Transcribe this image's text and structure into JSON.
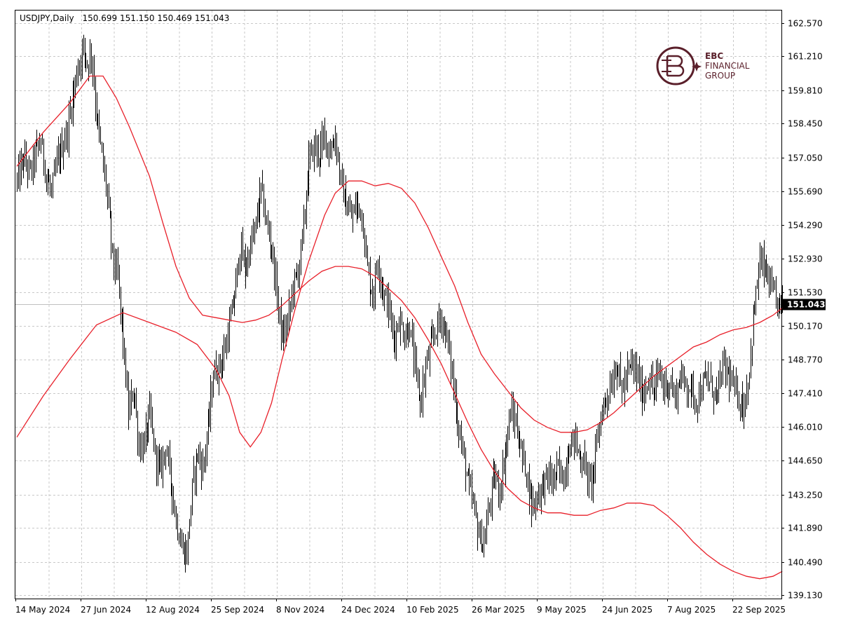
{
  "header": {
    "symbol": "USDJPY,Daily",
    "ohlc": "150.699 151.150 150.469 151.043"
  },
  "logo": {
    "line1": "EBC",
    "line2": "FINANCIAL",
    "line3": "GROUP",
    "color": "#5a1f2a",
    "icon": "ebc-logo-icon"
  },
  "colors": {
    "bars": "#000000",
    "ma": "#e8202a",
    "grid": "#c8c8c8",
    "price_line": "#c0c0c0",
    "price_tag_bg": "#000000",
    "price_tag_text": "#ffffff"
  },
  "chart_data": {
    "type": "ohlc-bar",
    "x_labels": [
      "14 May 2024",
      "27 Jun 2024",
      "12 Aug 2024",
      "25 Sep 2024",
      "8 Nov 2024",
      "24 Dec 2024",
      "10 Feb 2025",
      "26 Mar 2025",
      "9 May 2025",
      "24 Jun 2025",
      "7 Aug 2025",
      "22 Sep 2025"
    ],
    "y_labels": [
      "162.570",
      "161.210",
      "159.810",
      "158.450",
      "157.050",
      "155.690",
      "154.290",
      "152.930",
      "151.530",
      "150.170",
      "148.770",
      "147.410",
      "146.010",
      "144.650",
      "143.250",
      "141.890",
      "140.490",
      "139.130"
    ],
    "ylim": [
      139.13,
      162.57
    ],
    "current_price": 151.043,
    "current_price_label": "151.043",
    "grid": true,
    "close_path": [
      [
        0,
        156.1
      ],
      [
        5,
        157.0
      ],
      [
        10,
        156.4
      ],
      [
        14,
        157.3
      ],
      [
        18,
        157.7
      ],
      [
        22,
        156.3
      ],
      [
        26,
        155.6
      ],
      [
        30,
        156.8
      ],
      [
        34,
        157.5
      ],
      [
        38,
        158.2
      ],
      [
        42,
        159.6
      ],
      [
        46,
        160.8
      ],
      [
        50,
        161.6
      ],
      [
        53,
        160.9
      ],
      [
        56,
        161.4
      ],
      [
        60,
        158.8
      ],
      [
        64,
        157.1
      ],
      [
        68,
        155.5
      ],
      [
        72,
        153.0
      ],
      [
        76,
        152.1
      ],
      [
        80,
        149.5
      ],
      [
        84,
        146.6
      ],
      [
        88,
        147.6
      ],
      [
        92,
        145.2
      ],
      [
        96,
        145.3
      ],
      [
        100,
        146.6
      ],
      [
        104,
        144.9
      ],
      [
        108,
        144.2
      ],
      [
        112,
        145.3
      ],
      [
        116,
        143.8
      ],
      [
        120,
        142.2
      ],
      [
        124,
        141.1
      ],
      [
        128,
        140.8
      ],
      [
        132,
        143.5
      ],
      [
        136,
        145.0
      ],
      [
        140,
        144.3
      ],
      [
        144,
        146.0
      ],
      [
        148,
        148.2
      ],
      [
        152,
        148.5
      ],
      [
        156,
        149.0
      ],
      [
        160,
        150.1
      ],
      [
        164,
        151.4
      ],
      [
        168,
        153.4
      ],
      [
        172,
        152.5
      ],
      [
        176,
        153.4
      ],
      [
        180,
        154.3
      ],
      [
        184,
        155.8
      ],
      [
        188,
        154.3
      ],
      [
        192,
        153.4
      ],
      [
        196,
        151.4
      ],
      [
        200,
        149.6
      ],
      [
        204,
        150.3
      ],
      [
        208,
        151.8
      ],
      [
        212,
        152.4
      ],
      [
        216,
        154.2
      ],
      [
        220,
        156.9
      ],
      [
        224,
        157.5
      ],
      [
        228,
        157.2
      ],
      [
        232,
        158.0
      ],
      [
        236,
        157.3
      ],
      [
        240,
        157.9
      ],
      [
        244,
        156.1
      ],
      [
        248,
        155.1
      ],
      [
        252,
        154.6
      ],
      [
        256,
        155.1
      ],
      [
        260,
        154.8
      ],
      [
        264,
        152.5
      ],
      [
        268,
        151.4
      ],
      [
        272,
        152.9
      ],
      [
        276,
        151.5
      ],
      [
        280,
        151.0
      ],
      [
        284,
        149.6
      ],
      [
        288,
        150.4
      ],
      [
        292,
        149.8
      ],
      [
        296,
        150.1
      ],
      [
        300,
        148.4
      ],
      [
        304,
        147.0
      ],
      [
        308,
        148.4
      ],
      [
        312,
        149.3
      ],
      [
        316,
        150.1
      ],
      [
        320,
        150.5
      ],
      [
        324,
        149.7
      ],
      [
        328,
        148.2
      ],
      [
        332,
        146.3
      ],
      [
        336,
        145.0
      ],
      [
        340,
        143.7
      ],
      [
        344,
        142.8
      ],
      [
        348,
        141.6
      ],
      [
        352,
        141.2
      ],
      [
        356,
        142.8
      ],
      [
        360,
        144.0
      ],
      [
        364,
        143.4
      ],
      [
        368,
        145.0
      ],
      [
        372,
        146.6
      ],
      [
        376,
        146.2
      ],
      [
        380,
        145.0
      ],
      [
        384,
        144.2
      ],
      [
        388,
        142.8
      ],
      [
        392,
        143.2
      ],
      [
        396,
        143.6
      ],
      [
        400,
        144.0
      ],
      [
        404,
        143.8
      ],
      [
        408,
        144.3
      ],
      [
        412,
        143.9
      ],
      [
        416,
        145.2
      ],
      [
        420,
        145.6
      ],
      [
        424,
        144.8
      ],
      [
        428,
        144.5
      ],
      [
        432,
        143.6
      ],
      [
        436,
        144.8
      ],
      [
        440,
        146.5
      ],
      [
        444,
        147.2
      ],
      [
        448,
        147.8
      ],
      [
        452,
        148.6
      ],
      [
        456,
        147.5
      ],
      [
        460,
        148.2
      ],
      [
        464,
        148.6
      ],
      [
        468,
        148.0
      ],
      [
        472,
        147.3
      ],
      [
        476,
        148.1
      ],
      [
        480,
        147.4
      ],
      [
        484,
        148.3
      ],
      [
        488,
        147.6
      ],
      [
        492,
        147.9
      ],
      [
        496,
        147.2
      ],
      [
        500,
        148.1
      ],
      [
        504,
        147.8
      ],
      [
        508,
        147.6
      ],
      [
        512,
        147.1
      ],
      [
        516,
        147.6
      ],
      [
        520,
        148.0
      ],
      [
        524,
        147.6
      ],
      [
        528,
        147.3
      ],
      [
        532,
        148.5
      ],
      [
        536,
        148.2
      ],
      [
        540,
        147.6
      ],
      [
        544,
        147.2
      ],
      [
        548,
        146.8
      ],
      [
        552,
        148.4
      ],
      [
        556,
        151.0
      ],
      [
        560,
        152.8
      ],
      [
        564,
        152.4
      ],
      [
        568,
        151.7
      ],
      [
        572,
        151.1
      ],
      [
        577,
        151.04
      ]
    ],
    "ma_fast": [
      [
        0,
        145.6
      ],
      [
        20,
        147.3
      ],
      [
        40,
        148.8
      ],
      [
        60,
        150.2
      ],
      [
        80,
        150.7
      ],
      [
        100,
        150.3
      ],
      [
        120,
        149.9
      ],
      [
        136,
        149.4
      ],
      [
        150,
        148.4
      ],
      [
        160,
        147.3
      ],
      [
        168,
        145.8
      ],
      [
        176,
        145.2
      ],
      [
        184,
        145.8
      ],
      [
        192,
        147.0
      ],
      [
        200,
        148.8
      ],
      [
        210,
        150.9
      ],
      [
        220,
        152.8
      ],
      [
        232,
        154.7
      ],
      [
        240,
        155.6
      ],
      [
        250,
        156.1
      ],
      [
        260,
        156.1
      ],
      [
        270,
        155.9
      ],
      [
        280,
        156.0
      ],
      [
        290,
        155.8
      ],
      [
        300,
        155.2
      ],
      [
        310,
        154.2
      ],
      [
        320,
        153.0
      ],
      [
        330,
        151.8
      ],
      [
        340,
        150.3
      ],
      [
        350,
        149.0
      ],
      [
        360,
        148.2
      ],
      [
        370,
        147.5
      ],
      [
        380,
        146.8
      ],
      [
        390,
        146.3
      ],
      [
        400,
        146.0
      ],
      [
        410,
        145.8
      ],
      [
        420,
        145.8
      ],
      [
        430,
        145.9
      ],
      [
        440,
        146.2
      ],
      [
        450,
        146.6
      ],
      [
        460,
        147.1
      ],
      [
        470,
        147.6
      ],
      [
        480,
        148.1
      ],
      [
        490,
        148.5
      ],
      [
        500,
        148.9
      ],
      [
        510,
        149.3
      ],
      [
        520,
        149.5
      ],
      [
        530,
        149.8
      ],
      [
        540,
        150.0
      ],
      [
        550,
        150.1
      ],
      [
        560,
        150.3
      ],
      [
        570,
        150.6
      ],
      [
        577,
        150.9
      ]
    ],
    "ma_slow": [
      [
        0,
        156.7
      ],
      [
        20,
        158.1
      ],
      [
        40,
        159.3
      ],
      [
        55,
        160.4
      ],
      [
        65,
        160.4
      ],
      [
        75,
        159.5
      ],
      [
        85,
        158.3
      ],
      [
        100,
        156.3
      ],
      [
        110,
        154.4
      ],
      [
        120,
        152.6
      ],
      [
        130,
        151.3
      ],
      [
        140,
        150.6
      ],
      [
        150,
        150.5
      ],
      [
        160,
        150.4
      ],
      [
        170,
        150.3
      ],
      [
        180,
        150.4
      ],
      [
        190,
        150.6
      ],
      [
        200,
        151.0
      ],
      [
        210,
        151.5
      ],
      [
        220,
        152.0
      ],
      [
        230,
        152.4
      ],
      [
        240,
        152.6
      ],
      [
        250,
        152.6
      ],
      [
        260,
        152.5
      ],
      [
        270,
        152.2
      ],
      [
        280,
        151.7
      ],
      [
        290,
        151.2
      ],
      [
        300,
        150.5
      ],
      [
        310,
        149.6
      ],
      [
        320,
        148.6
      ],
      [
        330,
        147.4
      ],
      [
        340,
        146.2
      ],
      [
        350,
        145.1
      ],
      [
        360,
        144.2
      ],
      [
        370,
        143.5
      ],
      [
        380,
        143.0
      ],
      [
        390,
        142.7
      ],
      [
        400,
        142.5
      ],
      [
        410,
        142.5
      ],
      [
        420,
        142.4
      ],
      [
        430,
        142.4
      ],
      [
        440,
        142.6
      ],
      [
        450,
        142.7
      ],
      [
        460,
        142.9
      ],
      [
        470,
        142.9
      ],
      [
        480,
        142.8
      ],
      [
        490,
        142.4
      ],
      [
        500,
        141.9
      ],
      [
        510,
        141.3
      ],
      [
        520,
        140.8
      ],
      [
        530,
        140.4
      ],
      [
        540,
        140.1
      ],
      [
        550,
        139.9
      ],
      [
        560,
        139.8
      ],
      [
        570,
        139.9
      ],
      [
        577,
        140.1
      ]
    ]
  }
}
